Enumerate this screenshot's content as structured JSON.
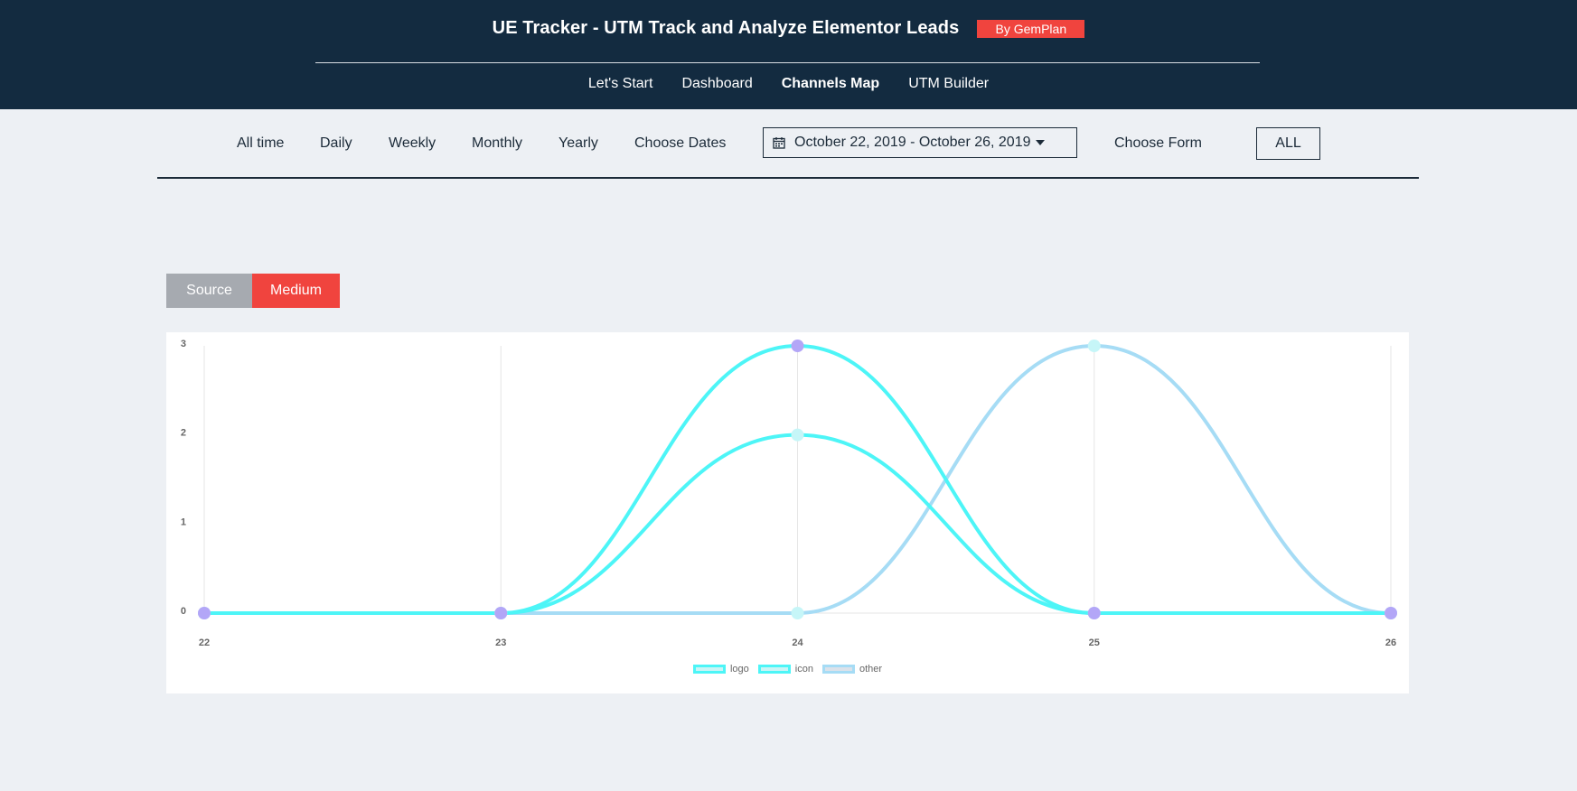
{
  "header": {
    "title": "UE Tracker - UTM Track and Analyze Elementor Leads",
    "badge": "By GemPlan",
    "nav": [
      "Let's Start",
      "Dashboard",
      "Channels Map",
      "UTM Builder"
    ],
    "active_nav": "Channels Map"
  },
  "filters": {
    "periods": [
      "All time",
      "Daily",
      "Weekly",
      "Monthly",
      "Yearly",
      "Choose Dates"
    ],
    "date_range": "October 22, 2019 - October 26, 2019",
    "choose_form_label": "Choose Form",
    "form_value": "ALL"
  },
  "toggle": {
    "source": "Source",
    "medium": "Medium",
    "active": "Medium"
  },
  "colors": {
    "header_bg": "#132b40",
    "accent": "#f0443e",
    "point": "#b3a6f7"
  },
  "chart_data": {
    "type": "line",
    "x": [
      "22",
      "23",
      "24",
      "25",
      "26"
    ],
    "ylim": [
      0,
      3
    ],
    "yticks": [
      "0",
      "1",
      "2",
      "3"
    ],
    "series": [
      {
        "name": "logo",
        "values": [
          0,
          0,
          3,
          0,
          0
        ],
        "color": "#4df5f7",
        "point_color": "#b3a6f7"
      },
      {
        "name": "icon",
        "values": [
          0,
          0,
          2,
          0,
          0
        ],
        "color": "#4df5f7",
        "point_color": "#c6f6f8"
      },
      {
        "name": "other",
        "values": [
          0,
          0,
          0,
          3,
          0
        ],
        "color": "#a6dcf5",
        "point_color": "#c6f6f8"
      }
    ],
    "grid": true,
    "legend_position": "bottom"
  }
}
